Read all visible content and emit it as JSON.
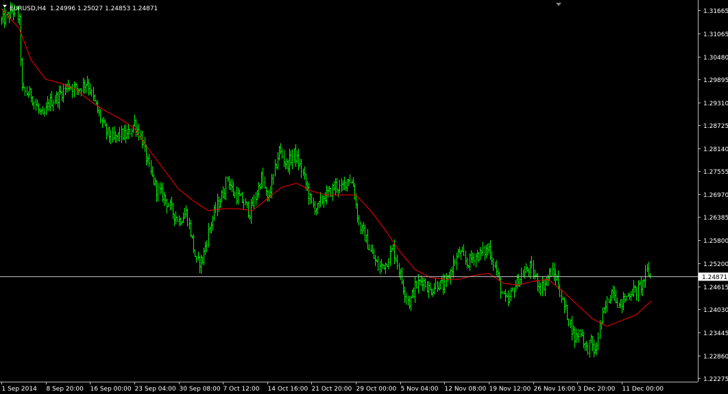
{
  "window": {
    "symbol": "EURUSD",
    "timeframe": "H4",
    "header_text": "EURUSD,H4  1.24996 1.25027 1.24853 1.24871"
  },
  "colors": {
    "background": "#000000",
    "bars": "#00ff00",
    "moving_average": "#ff0000",
    "axis": "#c0c0c0",
    "text": "#ffffff",
    "price_line": "#c0c0c0",
    "price_label_bg": "#ffffff",
    "price_label_text": "#000000"
  },
  "chart_data": {
    "type": "ohlc",
    "symbol": "EURUSD",
    "timeframe": "H4",
    "last_bar": {
      "open": 1.24996,
      "high": 1.25027,
      "low": 1.24853,
      "close": 1.24871
    },
    "current_price": 1.24871,
    "y_ticks": [
      "1.31665",
      "1.31065",
      "1.30480",
      "1.29895",
      "1.29310",
      "1.28725",
      "1.28140",
      "1.27555",
      "1.26970",
      "1.26385",
      "1.25800",
      "1.25200",
      "1.24615",
      "1.24030",
      "1.23445",
      "1.22860",
      "1.22275"
    ],
    "ylim": [
      1.2219,
      1.3192
    ],
    "x_ticks": [
      "1 Sep 2014",
      "8 Sep 20:00",
      "16 Sep 00:00",
      "23 Sep 04:00",
      "30 Sep 08:00",
      "7 Oct 12:00",
      "14 Oct 16:00",
      "21 Oct 20:00",
      "29 Oct 00:00",
      "5 Nov 04:00",
      "12 Nov 08:00",
      "19 Nov 12:00",
      "26 Nov 16:00",
      "3 Dec 20:00",
      "11 Dec 00:00"
    ],
    "x_tick_bar_index": [
      0,
      30,
      60,
      90,
      120,
      150,
      180,
      210,
      240,
      270,
      300,
      330,
      360,
      390,
      420
    ],
    "close_path_anchors": [
      [
        0,
        1.314
      ],
      [
        3,
        1.3145
      ],
      [
        7,
        1.3165
      ],
      [
        10,
        1.316
      ],
      [
        12,
        1.3135
      ],
      [
        14,
        1.296
      ],
      [
        20,
        1.295
      ],
      [
        25,
        1.291
      ],
      [
        28,
        1.289
      ],
      [
        32,
        1.293
      ],
      [
        38,
        1.2945
      ],
      [
        45,
        1.2975
      ],
      [
        52,
        1.2965
      ],
      [
        58,
        1.2985
      ],
      [
        62,
        1.294
      ],
      [
        66,
        1.29
      ],
      [
        70,
        1.286
      ],
      [
        76,
        1.2835
      ],
      [
        80,
        1.285
      ],
      [
        85,
        1.2845
      ],
      [
        90,
        1.288
      ],
      [
        95,
        1.2835
      ],
      [
        100,
        1.276
      ],
      [
        105,
        1.271
      ],
      [
        110,
        1.269
      ],
      [
        116,
        1.265
      ],
      [
        120,
        1.263
      ],
      [
        125,
        1.265
      ],
      [
        128,
        1.26
      ],
      [
        132,
        1.252
      ],
      [
        136,
        1.253
      ],
      [
        140,
        1.26
      ],
      [
        145,
        1.266
      ],
      [
        150,
        1.27
      ],
      [
        153,
        1.274
      ],
      [
        157,
        1.27
      ],
      [
        163,
        1.268
      ],
      [
        168,
        1.265
      ],
      [
        172,
        1.269
      ],
      [
        176,
        1.274
      ],
      [
        180,
        1.268
      ],
      [
        184,
        1.274
      ],
      [
        188,
        1.281
      ],
      [
        193,
        1.277
      ],
      [
        198,
        1.28
      ],
      [
        203,
        1.276
      ],
      [
        207,
        1.271
      ],
      [
        210,
        1.267
      ],
      [
        214,
        1.266
      ],
      [
        218,
        1.269
      ],
      [
        222,
        1.27
      ],
      [
        226,
        1.272
      ],
      [
        230,
        1.271
      ],
      [
        235,
        1.274
      ],
      [
        238,
        1.272
      ],
      [
        242,
        1.262
      ],
      [
        246,
        1.259
      ],
      [
        250,
        1.255
      ],
      [
        255,
        1.251
      ],
      [
        260,
        1.252
      ],
      [
        265,
        1.256
      ],
      [
        268,
        1.252
      ],
      [
        272,
        1.246
      ],
      [
        276,
        1.242
      ],
      [
        280,
        1.246
      ],
      [
        285,
        1.248
      ],
      [
        290,
        1.245
      ],
      [
        295,
        1.247
      ],
      [
        300,
        1.246
      ],
      [
        305,
        1.251
      ],
      [
        310,
        1.255
      ],
      [
        315,
        1.252
      ],
      [
        320,
        1.254
      ],
      [
        325,
        1.2545
      ],
      [
        330,
        1.256
      ],
      [
        335,
        1.25
      ],
      [
        340,
        1.243
      ],
      [
        343,
        1.242
      ],
      [
        347,
        1.246
      ],
      [
        352,
        1.249
      ],
      [
        358,
        1.251
      ],
      [
        362,
        1.248
      ],
      [
        365,
        1.246
      ],
      [
        368,
        1.247
      ],
      [
        372,
        1.25
      ],
      [
        376,
        1.248
      ],
      [
        380,
        1.242
      ],
      [
        384,
        1.238
      ],
      [
        388,
        1.233
      ],
      [
        392,
        1.235
      ],
      [
        396,
        1.23
      ],
      [
        399,
        1.232
      ],
      [
        402,
        1.229
      ],
      [
        405,
        1.236
      ],
      [
        410,
        1.242
      ],
      [
        414,
        1.246
      ],
      [
        418,
        1.241
      ],
      [
        422,
        1.243
      ],
      [
        426,
        1.245
      ],
      [
        430,
        1.245
      ],
      [
        434,
        1.247
      ],
      [
        437,
        1.25
      ],
      [
        440,
        1.2487
      ]
    ],
    "ma_anchors": [
      [
        0,
        1.317
      ],
      [
        12,
        1.312
      ],
      [
        20,
        1.304
      ],
      [
        30,
        1.299
      ],
      [
        40,
        1.298
      ],
      [
        50,
        1.2965
      ],
      [
        60,
        1.2935
      ],
      [
        70,
        1.291
      ],
      [
        80,
        1.289
      ],
      [
        90,
        1.2865
      ],
      [
        100,
        1.281
      ],
      [
        110,
        1.276
      ],
      [
        120,
        1.271
      ],
      [
        130,
        1.268
      ],
      [
        140,
        1.2655
      ],
      [
        150,
        1.266
      ],
      [
        160,
        1.266
      ],
      [
        170,
        1.2655
      ],
      [
        180,
        1.2685
      ],
      [
        190,
        1.2715
      ],
      [
        200,
        1.2725
      ],
      [
        210,
        1.2705
      ],
      [
        220,
        1.2695
      ],
      [
        230,
        1.2695
      ],
      [
        240,
        1.2695
      ],
      [
        250,
        1.2655
      ],
      [
        260,
        1.2605
      ],
      [
        270,
        1.255
      ],
      [
        280,
        1.2505
      ],
      [
        290,
        1.2485
      ],
      [
        300,
        1.248
      ],
      [
        310,
        1.248
      ],
      [
        320,
        1.249
      ],
      [
        330,
        1.2495
      ],
      [
        340,
        1.247
      ],
      [
        350,
        1.2465
      ],
      [
        360,
        1.2475
      ],
      [
        370,
        1.248
      ],
      [
        380,
        1.245
      ],
      [
        390,
        1.2415
      ],
      [
        400,
        1.238
      ],
      [
        410,
        1.236
      ],
      [
        420,
        1.2375
      ],
      [
        430,
        1.239
      ],
      [
        440,
        1.2425
      ]
    ],
    "bar_count": 440
  }
}
